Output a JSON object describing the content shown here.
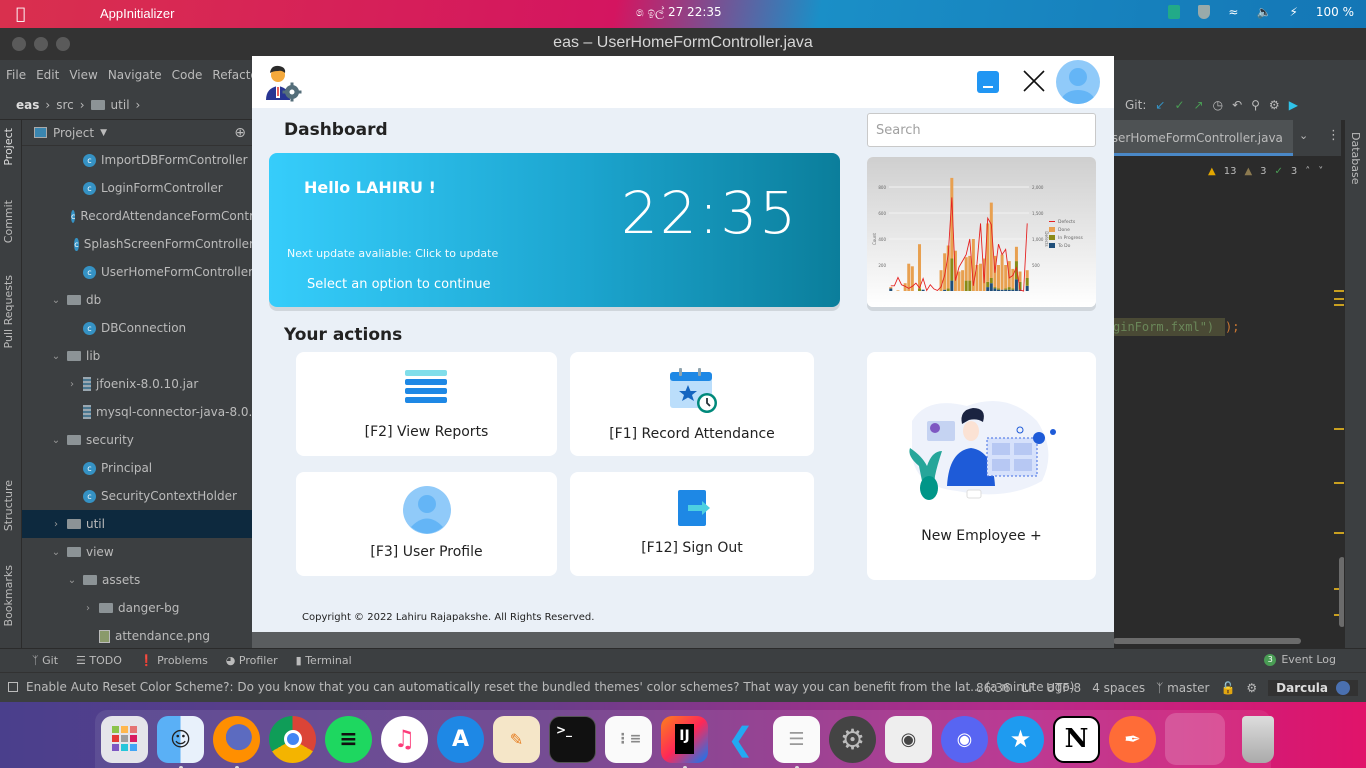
{
  "system_bar": {
    "app_name": "AppInitializer",
    "clock": "෧ ඉල් 27  22:35",
    "battery": "100 %"
  },
  "ide": {
    "window_title": "eas – UserHomeFormController.java",
    "menu": [
      "File",
      "Edit",
      "View",
      "Navigate",
      "Code",
      "Refactor"
    ],
    "breadcrumb": [
      "eas",
      "src",
      "util"
    ],
    "left_tabs": [
      "Project",
      "Commit",
      "Pull Requests",
      "Structure",
      "Bookmarks"
    ],
    "project_panel_title": "Project",
    "tree": [
      {
        "label": "ImportDBFormController",
        "type": "class",
        "indent": 3
      },
      {
        "label": "LoginFormController",
        "type": "class",
        "indent": 3
      },
      {
        "label": "RecordAttendanceFormController",
        "type": "class",
        "indent": 3
      },
      {
        "label": "SplashScreenFormController",
        "type": "class",
        "indent": 3
      },
      {
        "label": "UserHomeFormController",
        "type": "class",
        "indent": 3
      },
      {
        "label": "db",
        "type": "folder",
        "indent": 2,
        "expanded": true
      },
      {
        "label": "DBConnection",
        "type": "class",
        "indent": 3
      },
      {
        "label": "lib",
        "type": "folder",
        "indent": 2,
        "expanded": true
      },
      {
        "label": "jfoenix-8.0.10.jar",
        "type": "jar",
        "indent": 3,
        "collapsed": true
      },
      {
        "label": "mysql-connector-java-8.0.",
        "type": "jar",
        "indent": 3
      },
      {
        "label": "security",
        "type": "folder",
        "indent": 2,
        "expanded": true
      },
      {
        "label": "Principal",
        "type": "class",
        "indent": 3
      },
      {
        "label": "SecurityContextHolder",
        "type": "class",
        "indent": 3
      },
      {
        "label": "util",
        "type": "folder",
        "indent": 2,
        "collapsed": true,
        "selected": true
      },
      {
        "label": "view",
        "type": "folder",
        "indent": 2,
        "expanded": true
      },
      {
        "label": "assets",
        "type": "folder",
        "indent": 3,
        "expanded": true
      },
      {
        "label": "danger-bg",
        "type": "folder",
        "indent": 4,
        "collapsed": true
      },
      {
        "label": "attendance.png",
        "type": "image",
        "indent": 4
      }
    ],
    "git_label": "Git:",
    "editor_tab": "UserHomeFormController.java",
    "inspections": {
      "warnings": "13",
      "weak_warnings": "3",
      "typos": "3"
    },
    "code_fragment": "ginForm.fxml\")",
    "code_fragment_end": ");",
    "right_tab": "Database",
    "tool_windows": [
      "Git",
      "TODO",
      "Problems",
      "Profiler",
      "Terminal"
    ],
    "event_log": {
      "count": "3",
      "label": "Event Log"
    },
    "status_message": "Enable Auto Reset Color Scheme?: Do you know that you can automatically reset the bundled themes' color schemes? That way you can benefit from the lat... (a minute ago)",
    "status": {
      "position": "86:36",
      "line_sep": "LF",
      "encoding": "UTF-8",
      "indent": "4 spaces",
      "branch": "master",
      "theme": "Darcula"
    }
  },
  "app": {
    "dashboard_title": "Dashboard",
    "search": {
      "placeholder": "Search",
      "value": ""
    },
    "hero": {
      "greeting": "Hello LAHIRU !",
      "time": "22:35",
      "update_notice": "Next update avaliable: Click to update",
      "prompt": "Select an option to continue"
    },
    "actions_title": "Your actions",
    "actions": [
      {
        "label": "[F2] View Reports",
        "icon": "list-icon"
      },
      {
        "label": "[F1] Record Attendance",
        "icon": "calendar-clock-icon"
      },
      {
        "label": "[F3] User Profile",
        "icon": "user-profile-icon"
      },
      {
        "label": "[F12] Sign Out",
        "icon": "sign-out-icon"
      }
    ],
    "new_employee": {
      "label": "New Employee +"
    },
    "footer": "Copyright © 2022 Lahiru Rajapakshe. All Rights Reserved.",
    "colors": {
      "accent": "#2196f3",
      "hero_start": "#36cdfb",
      "hero_end": "#0b7e9b"
    }
  },
  "chart_data": {
    "type": "bar",
    "stacked": true,
    "title": "",
    "xlabel": "",
    "ylabel": "Count",
    "y2label": "Defects",
    "ylim": [
      0,
      800
    ],
    "y2lim": [
      0,
      2000
    ],
    "yticks": [
      200,
      400,
      600,
      800
    ],
    "y2ticks": [
      500,
      1000,
      1500,
      2000
    ],
    "grid": true,
    "legend": "right",
    "series": [
      {
        "name": "To Do",
        "color": "#1f4e79",
        "values": [
          20,
          0,
          0,
          0,
          0,
          0,
          0,
          0,
          0,
          10,
          0,
          0,
          0,
          0,
          0,
          10,
          0,
          80,
          0,
          0,
          0,
          0,
          0,
          0,
          0,
          0,
          0,
          30,
          60,
          20,
          10,
          10,
          10,
          10,
          10,
          90,
          10,
          0,
          40
        ]
      },
      {
        "name": "In Progress",
        "color": "#8a8a16",
        "values": [
          0,
          0,
          0,
          0,
          0,
          0,
          0,
          0,
          20,
          0,
          0,
          0,
          0,
          0,
          0,
          0,
          20,
          170,
          0,
          0,
          0,
          80,
          80,
          0,
          0,
          0,
          0,
          40,
          40,
          10,
          10,
          0,
          10,
          20,
          10,
          140,
          60,
          0,
          60
        ]
      },
      {
        "name": "Done",
        "color": "#e8a050",
        "values": [
          10,
          0,
          5,
          0,
          60,
          210,
          190,
          0,
          340,
          0,
          0,
          0,
          0,
          0,
          160,
          280,
          330,
          620,
          310,
          150,
          160,
          180,
          190,
          400,
          200,
          210,
          250,
          450,
          580,
          240,
          180,
          270,
          180,
          200,
          150,
          110,
          80,
          0,
          60
        ]
      },
      {
        "name": "Defects",
        "type": "line",
        "color": "#e52222",
        "values": [
          100,
          100,
          260,
          120,
          90,
          50,
          90,
          150,
          60,
          240,
          10,
          120,
          40,
          10,
          80,
          300,
          700,
          1800,
          200,
          460,
          580,
          700,
          1000,
          100,
          520,
          1300,
          150,
          1400,
          1280,
          350,
          900,
          700,
          800,
          250,
          300,
          450,
          20,
          0,
          1300
        ]
      }
    ]
  }
}
